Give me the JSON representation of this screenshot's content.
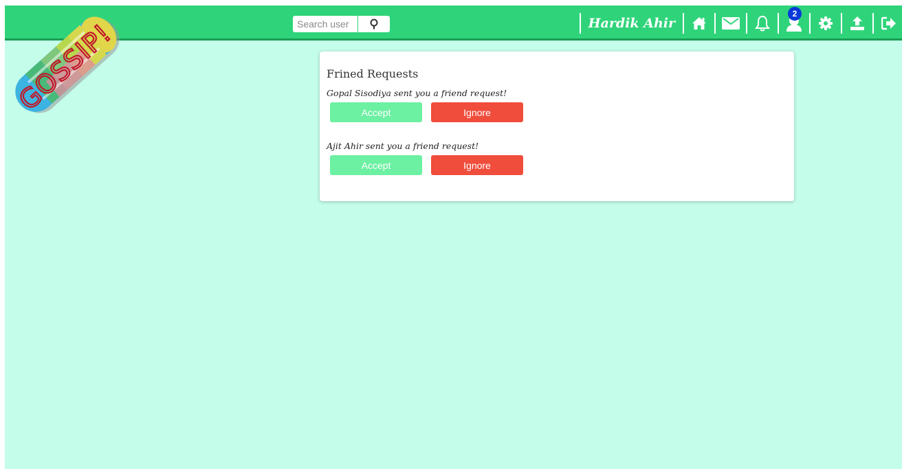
{
  "logo": {
    "text": "GOSSIP!"
  },
  "search": {
    "placeholder": "Search user"
  },
  "nav": {
    "user_name": "Hardik Ahir",
    "friend_request_count": "2",
    "icons": [
      "home-icon",
      "mail-icon",
      "bell-icon",
      "friend-requests-icon",
      "settings-icon",
      "upload-icon",
      "logout-icon"
    ]
  },
  "colors": {
    "navbar": "#2fd47a",
    "background": "#c4fdea",
    "accept": "#6cf0a2",
    "ignore": "#f04d3c",
    "badge": "#0b3ad8"
  },
  "requests": {
    "title": "Frined Requests",
    "items": [
      {
        "text": "Gopal Sisodiya sent you a friend request!",
        "accept_label": "Accept",
        "ignore_label": "Ignore"
      },
      {
        "text": "Ajit Ahir sent you a friend request!",
        "accept_label": "Accept",
        "ignore_label": "Ignore"
      }
    ]
  }
}
